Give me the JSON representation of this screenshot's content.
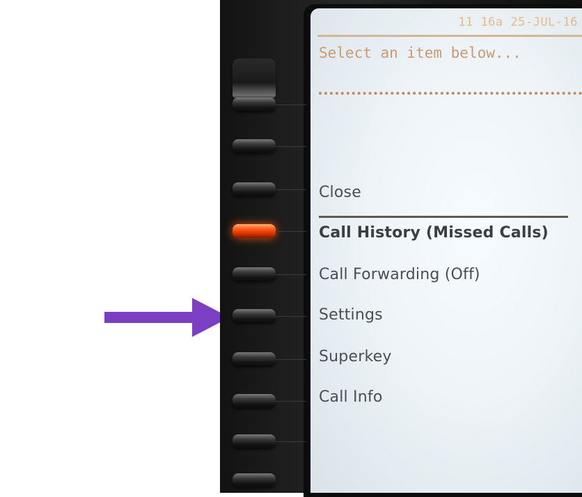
{
  "status": {
    "time_date": "11 16a 25-JUL-16"
  },
  "screen": {
    "prompt": "Select an item below..."
  },
  "menu": {
    "close_label": "Close",
    "items": [
      {
        "label": "Call History (Missed Calls)"
      },
      {
        "label": "Call Forwarding (Off)"
      },
      {
        "label": "Settings"
      },
      {
        "label": "Superkey"
      },
      {
        "label": "Call Info"
      }
    ]
  },
  "colors": {
    "arrow": "#7b3fc4",
    "active_key_led": "#ff4a10",
    "screen_bg": "#eef4f8",
    "status_text": "#e8b98a",
    "menu_text": "#4a4d52"
  },
  "annotation": {
    "arrow_icon": "arrow-right-icon",
    "points_to": "Settings"
  }
}
